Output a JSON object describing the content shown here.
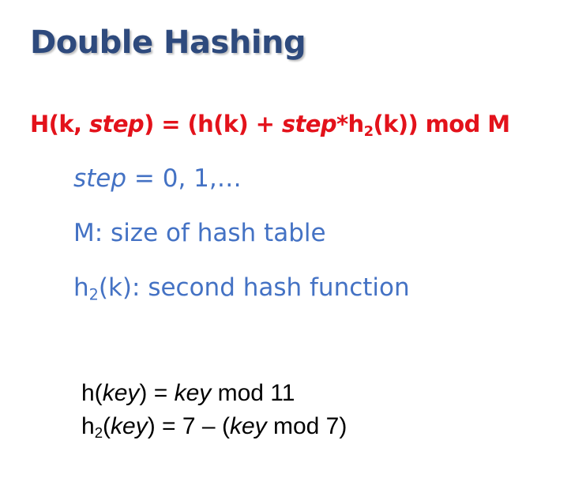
{
  "colors": {
    "title": "#2e4a7d",
    "formula": "#e3121b",
    "body": "#4472c4",
    "hash": "#000000"
  },
  "title": "Double Hashing",
  "formula": {
    "p1": "H(k, ",
    "step1": "step",
    "p2": ") = (h(k) + ",
    "step2": "step",
    "p3": "*h",
    "sub": "2",
    "p4": "(k)) mod M"
  },
  "lines": {
    "step_var": "step",
    "step_rest": " = 0, 1,…",
    "size": "M: size of hash table",
    "h2_h": "h",
    "h2_sub": "2",
    "h2_rest": "(k): second hash function"
  },
  "hash1": {
    "a": "h(",
    "key1": "key",
    "b": ") = ",
    "key2": "key",
    "c": " mod 11"
  },
  "hash2": {
    "a": "h",
    "sub": "2",
    "b": "(",
    "key1": "key",
    "c": ") = 7 – (",
    "key2": "key",
    "d": " mod 7)"
  }
}
